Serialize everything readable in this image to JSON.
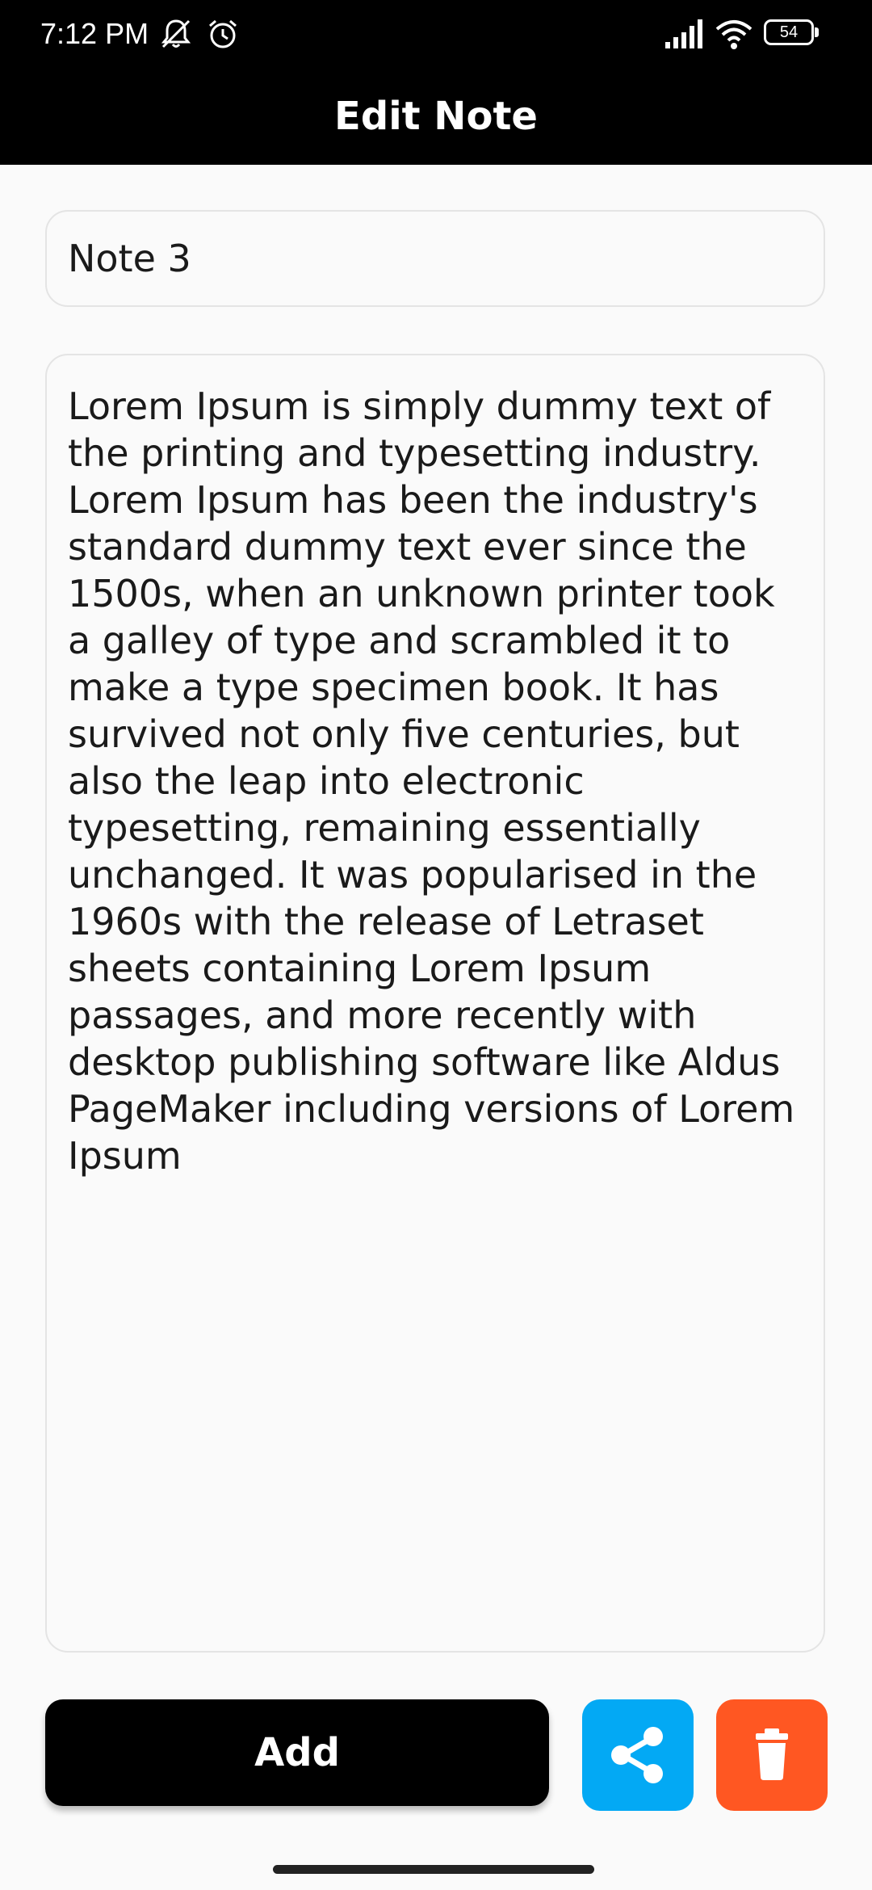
{
  "status_bar": {
    "time": "7:12 PM",
    "battery": "54",
    "icons": [
      "muted-bell-icon",
      "alarm-icon",
      "signal-icon",
      "wifi-icon",
      "battery-icon"
    ]
  },
  "app_bar": {
    "title": "Edit Note"
  },
  "note": {
    "title": "Note 3",
    "body": "Lorem Ipsum is simply dummy text of the printing and typesetting industry. Lorem Ipsum has been the industry's standard dummy text ever since the 1500s, when an unknown printer took a galley of type and scrambled it to make a type specimen book. It has survived not only five centuries, but also the leap into electronic typesetting, remaining essentially unchanged. It was popularised in the 1960s with the release of Letraset sheets containing Lorem Ipsum passages, and more recently with desktop publishing software like Aldus PageMaker including versions of Lorem Ipsum"
  },
  "actions": {
    "add_label": "Add",
    "share_icon": "share-icon",
    "delete_icon": "trash-icon"
  },
  "colors": {
    "app_bar": "#000000",
    "add_button": "#000000",
    "share_button": "#03a9f4",
    "delete_button": "#ff5722",
    "background": "#fafafa"
  }
}
